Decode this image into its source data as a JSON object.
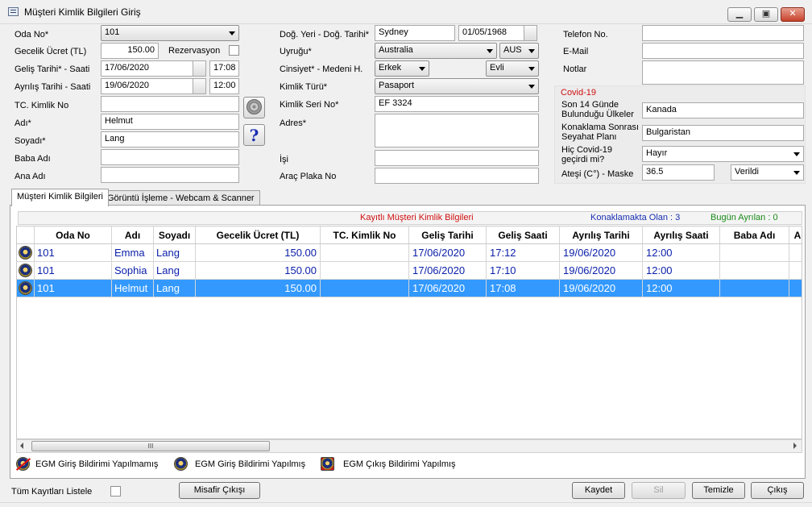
{
  "window": {
    "title": "Müşteri Kimlik Bilgileri Giriş",
    "minimize": "▁",
    "maximize": "▣",
    "close": "✕"
  },
  "form": {
    "oda_no_label": "Oda No*",
    "oda_no_value": "101",
    "gecelik_label": "Gecelik Ücret (TL)",
    "gecelik_value": "150.00",
    "rezervasyon_label": "Rezervasyon",
    "gelis_label": "Geliş Tarihi* - Saati",
    "gelis_date": "17/06/2020",
    "gelis_time": "17:08",
    "ayrilis_label": "Ayrılış Tarihi - Saati",
    "ayrilis_date": "19/06/2020",
    "ayrilis_time": "12:00",
    "tc_label": "TC. Kimlik No",
    "tc_value": "",
    "adi_label": "Adı*",
    "adi_value": "Helmut",
    "soyadi_label": "Soyadı*",
    "soyadi_value": "Lang",
    "baba_label": "Baba Adı",
    "baba_value": "",
    "ana_label": "Ana Adı",
    "ana_value": "",
    "help_symbol": "?",
    "dogum_label": "Doğ. Yeri - Doğ. Tarihi*",
    "dogum_yeri": "Sydney",
    "dogum_tarihi": "01/05/1968",
    "uyruk_label": "Uyruğu*",
    "uyruk_value": "Australia",
    "uyruk_code": "AUS",
    "cinsiyet_label": "Cinsiyet* - Medeni H.",
    "cinsiyet_value": "Erkek",
    "medeni_value": "Evli",
    "kimlik_turu_label": "Kimlik Türü*",
    "kimlik_turu_value": "Pasaport",
    "kimlik_seri_label": "Kimlik Seri No*",
    "kimlik_seri_value": "EF 3324",
    "adres_label": "Adres*",
    "adres_value": "",
    "isi_label": "İşi",
    "isi_value": "",
    "arac_label": "Araç Plaka No",
    "arac_value": "",
    "telefon_label": "Telefon No.",
    "telefon_value": "",
    "email_label": "E-Mail",
    "email_value": "",
    "notlar_label": "Notlar",
    "notlar_value": ""
  },
  "covid": {
    "title": "Covid-19",
    "son14_label_1": "Son 14 Günde",
    "son14_label_2": "Bulunduğu Ülkeler",
    "son14_value": "Kanada",
    "plan_label_1": "Konaklama Sonrası",
    "plan_label_2": "Seyahat Planı",
    "plan_value": "Bulgaristan",
    "gecirdi_label_1": "Hiç Covid-19",
    "gecirdi_label_2": "geçirdi mi?",
    "gecirdi_value": "Hayır",
    "ates_label": "Ateşi (C°) - Maske",
    "ates_value": "36.5",
    "maske_value": "Verildi"
  },
  "tabs": [
    "Müşteri Kimlik Bilgileri",
    "Görüntü İşleme - Webcam & Scanner"
  ],
  "grid": {
    "caption": "Kayıtlı Müşteri Kimlik Bilgileri",
    "konaklamakta": "Konaklamakta Olan : 3",
    "bugun_ayrilan": "Bugün Ayrılan : 0",
    "columns": [
      "Oda No",
      "Adı",
      "Soyadı",
      "Gecelik Ücret (TL)",
      "TC. Kimlik No",
      "Geliş Tarihi",
      "Geliş Saati",
      "Ayrılış Tarihi",
      "Ayrılış Saati",
      "Baba Adı",
      "A"
    ],
    "rows": [
      {
        "oda": "101",
        "adi": "Emma",
        "soyadi": "Lang",
        "ucret": "150.00",
        "tc": "",
        "gelis_t": "17/06/2020",
        "gelis_s": "17:12",
        "ayr_t": "19/06/2020",
        "ayr_s": "12:00",
        "baba": ""
      },
      {
        "oda": "101",
        "adi": "Sophia",
        "soyadi": "Lang",
        "ucret": "150.00",
        "tc": "",
        "gelis_t": "17/06/2020",
        "gelis_s": "17:10",
        "ayr_t": "19/06/2020",
        "ayr_s": "12:00",
        "baba": ""
      },
      {
        "oda": "101",
        "adi": "Helmut",
        "soyadi": "Lang",
        "ucret": "150.00",
        "tc": "",
        "gelis_t": "17/06/2020",
        "gelis_s": "17:08",
        "ayr_t": "19/06/2020",
        "ayr_s": "12:00",
        "baba": ""
      }
    ],
    "selected_row": 2,
    "scroll_thumb_glyph": "III"
  },
  "legend": {
    "item1": "EGM Giriş Bildirimi Yapılmamış",
    "item2": "EGM Giriş Bildirimi Yapılmış",
    "item3": "EGM Çıkış Bildirimi Yapılmış"
  },
  "footer": {
    "tum_kayitlar": "Tüm Kayıtları Listele",
    "misafir_cikisi": "Misafir Çıkışı",
    "kaydet": "Kaydet",
    "sil": "Sil",
    "temizle": "Temizle",
    "cikis": "Çıkış"
  },
  "colors": {
    "selection": "#3399ff",
    "row_text": "#0a1ea8",
    "caption_red": "#d01010",
    "konaklamakta_blue": "#1a2fb3",
    "bugun_green": "#1a8a1a"
  },
  "icons": [
    "app-form-icon",
    "camera-icon",
    "help-icon",
    "police-badge-icon",
    "police-badge-crossed-icon",
    "police-badge-exit-icon"
  ]
}
